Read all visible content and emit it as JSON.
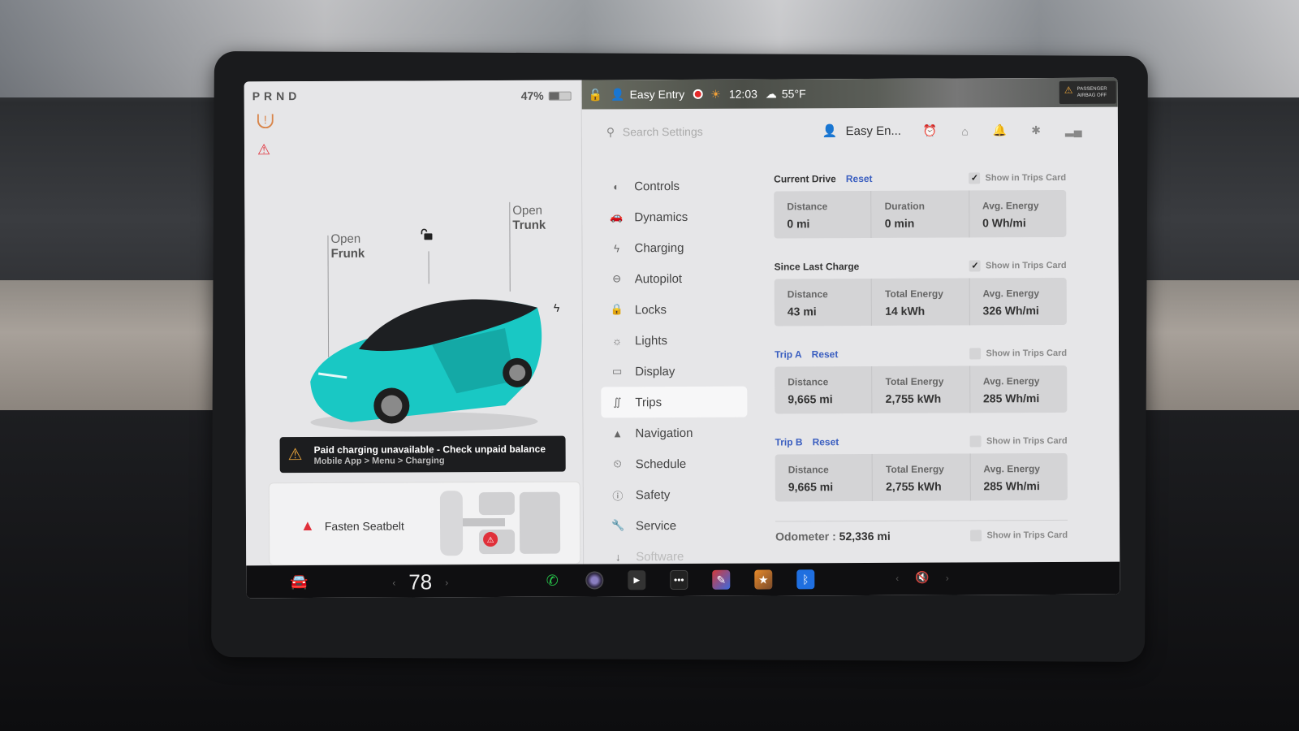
{
  "car_pane": {
    "gear": "PRND",
    "battery_percent_label": "47%",
    "battery_level": 0.47,
    "warnings": [
      "tire-pressure-warning",
      "seatbelt-warning"
    ],
    "open_frunk": {
      "line1": "Open",
      "line2": "Frunk"
    },
    "open_trunk": {
      "line1": "Open",
      "line2": "Trunk"
    },
    "car_color": "#19c8c4",
    "alert": {
      "title": "Paid charging unavailable - Check unpaid balance",
      "subtitle": "Mobile App > Menu > Charging"
    },
    "seatbelt_card": {
      "label": "Fasten Seatbelt"
    }
  },
  "status_bar": {
    "profile": "Easy Entry",
    "time": "12:03",
    "temperature": "55°F",
    "airbag_label": "PASSENGER AIRBAG OFF"
  },
  "settings_header": {
    "search_placeholder": "Search Settings",
    "profile_name": "Easy En..."
  },
  "nav": {
    "items": [
      {
        "label": "Controls",
        "icon": "toggle-icon"
      },
      {
        "label": "Dynamics",
        "icon": "car-icon"
      },
      {
        "label": "Charging",
        "icon": "bolt-icon"
      },
      {
        "label": "Autopilot",
        "icon": "steering-wheel-icon"
      },
      {
        "label": "Locks",
        "icon": "lock-icon"
      },
      {
        "label": "Lights",
        "icon": "light-icon"
      },
      {
        "label": "Display",
        "icon": "display-icon"
      },
      {
        "label": "Trips",
        "icon": "trips-icon",
        "active": true
      },
      {
        "label": "Navigation",
        "icon": "navigation-icon"
      },
      {
        "label": "Schedule",
        "icon": "alarm-icon"
      },
      {
        "label": "Safety",
        "icon": "info-icon"
      },
      {
        "label": "Service",
        "icon": "wrench-icon"
      },
      {
        "label": "Software",
        "icon": "download-icon"
      }
    ]
  },
  "trips": {
    "show_label": "Show in Trips Card",
    "reset_label": "Reset",
    "current_drive": {
      "title": "Current Drive",
      "show_checked": true,
      "stats": [
        {
          "label": "Distance",
          "value": "0 mi"
        },
        {
          "label": "Duration",
          "value": "0 min"
        },
        {
          "label": "Avg. Energy",
          "value": "0 Wh/mi"
        }
      ]
    },
    "since_last_charge": {
      "title": "Since Last Charge",
      "show_checked": true,
      "stats": [
        {
          "label": "Distance",
          "value": "43 mi"
        },
        {
          "label": "Total Energy",
          "value": "14 kWh"
        },
        {
          "label": "Avg. Energy",
          "value": "326 Wh/mi"
        }
      ]
    },
    "trip_a": {
      "title": "Trip A",
      "show_checked": false,
      "stats": [
        {
          "label": "Distance",
          "value": "9,665 mi"
        },
        {
          "label": "Total Energy",
          "value": "2,755 kWh"
        },
        {
          "label": "Avg. Energy",
          "value": "285 Wh/mi"
        }
      ]
    },
    "trip_b": {
      "title": "Trip B",
      "show_checked": false,
      "stats": [
        {
          "label": "Distance",
          "value": "9,665 mi"
        },
        {
          "label": "Total Energy",
          "value": "2,755 kWh"
        },
        {
          "label": "Avg. Energy",
          "value": "285 Wh/mi"
        }
      ]
    },
    "odometer": {
      "label": "Odometer :",
      "value": "52,336 mi",
      "show_checked": false
    }
  },
  "taskbar": {
    "cabin_temp": "78",
    "apps": [
      "phone",
      "camera",
      "theater",
      "more",
      "toybox",
      "arcade",
      "bluetooth"
    ],
    "volume": "muted"
  }
}
